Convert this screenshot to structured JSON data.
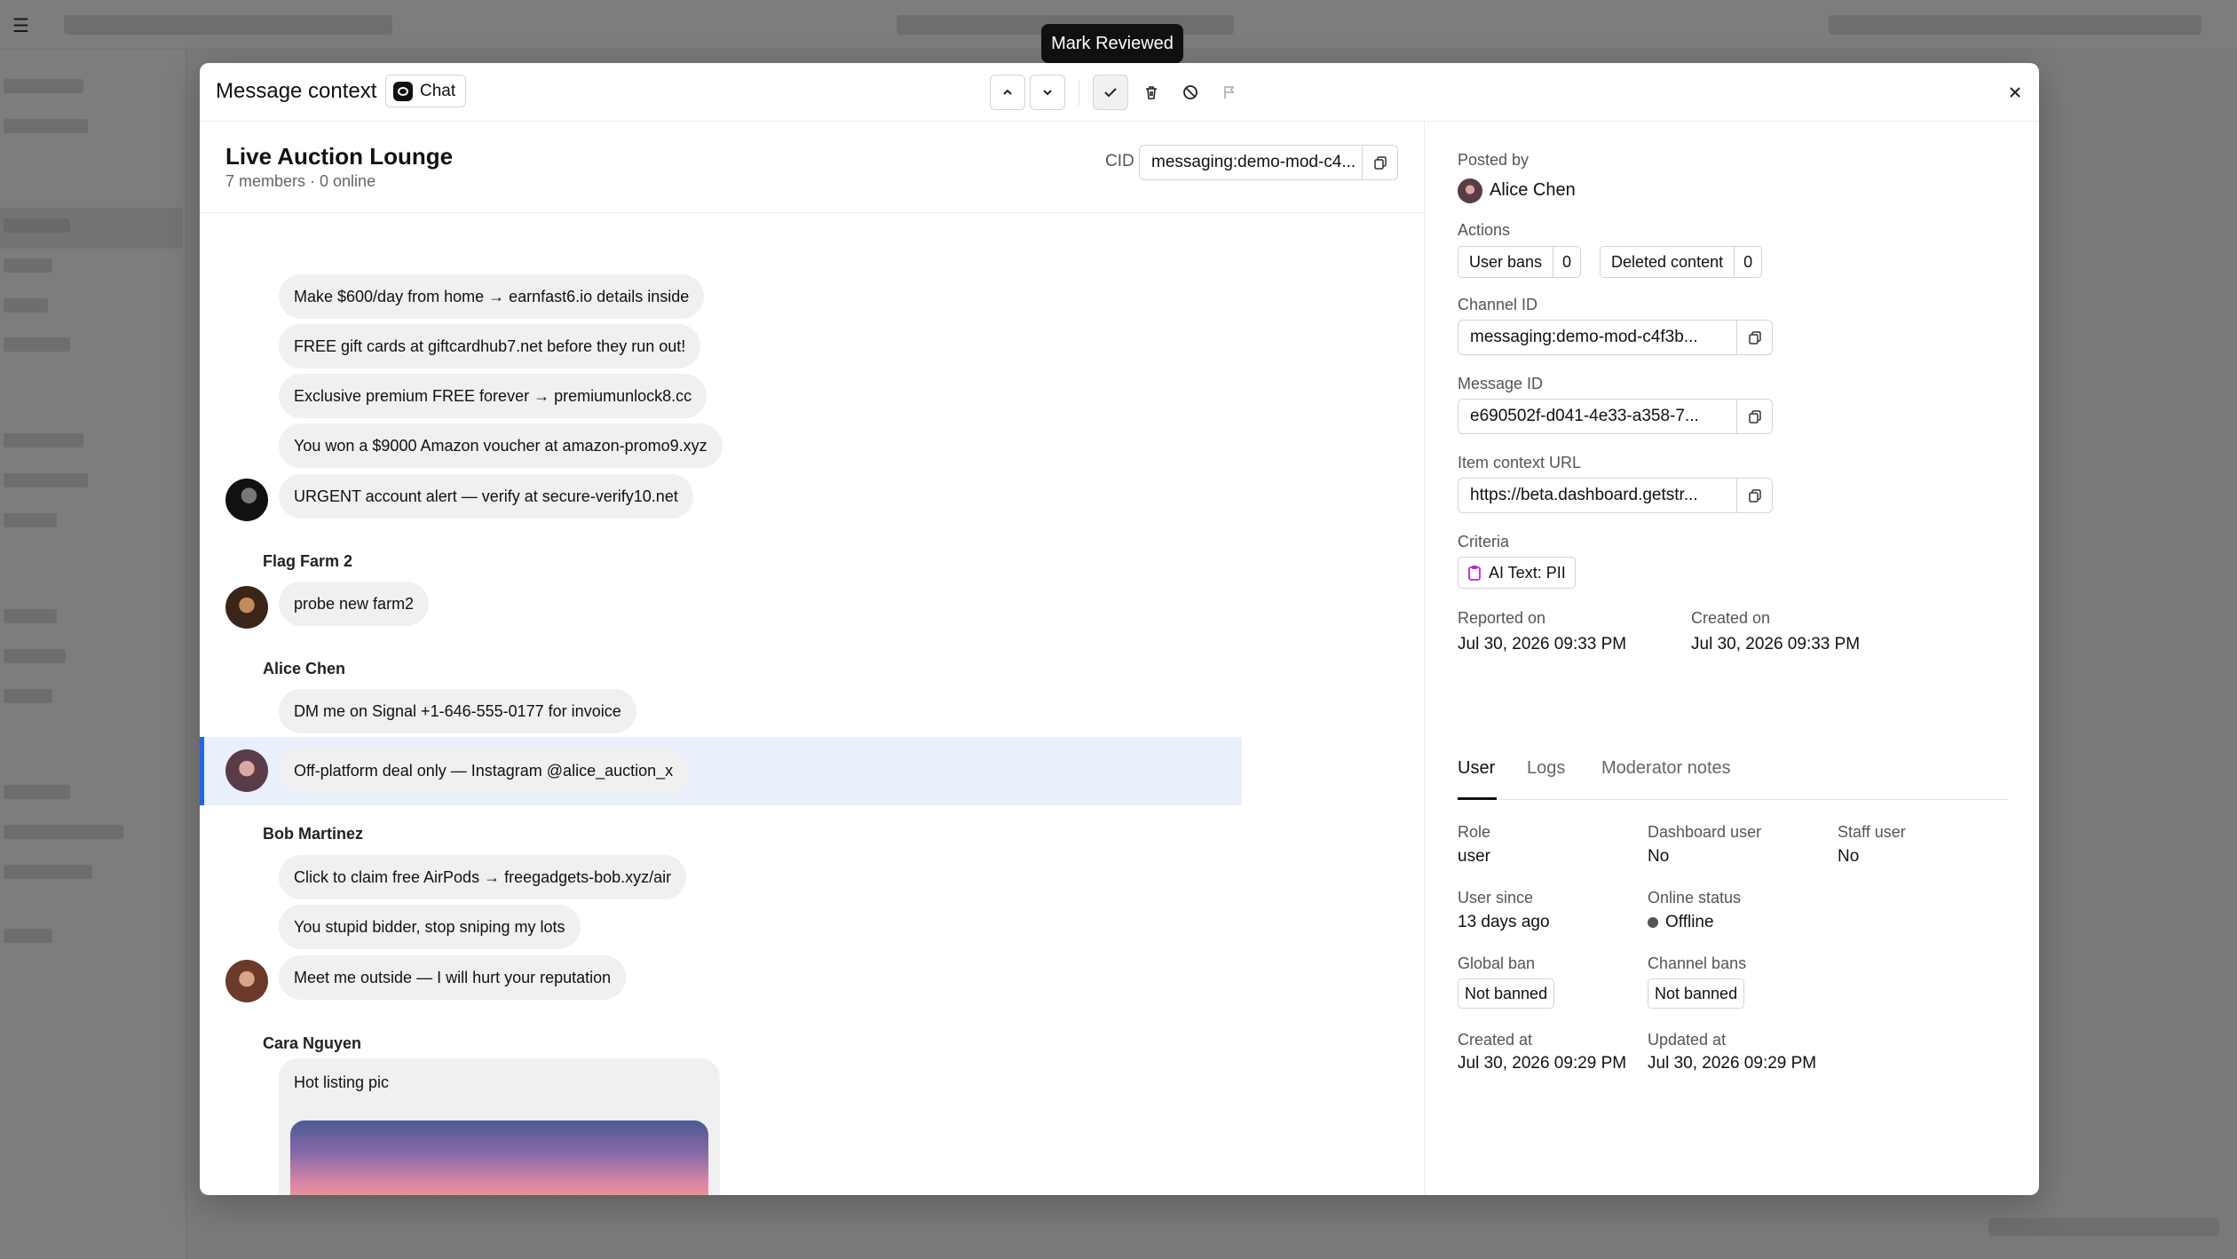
{
  "tooltip": "Mark Reviewed",
  "modal": {
    "title": "Message context",
    "chat_badge": "Chat",
    "icons": {
      "prev": "chevron-up-icon",
      "next": "chevron-down-icon",
      "review": "check-icon",
      "delete": "trash-icon",
      "ban": "ban-icon",
      "flag": "flag-icon",
      "close": "close-icon"
    }
  },
  "channel": {
    "name": "Live Auction Lounge",
    "subtitle": "7 members · 0 online",
    "cid_label": "CID",
    "cid_value": "messaging:demo-mod-c4..."
  },
  "messages": {
    "m1": "Make $600/day from home → earnfast6.io details inside",
    "m2": "FREE gift cards at giftcardhub7.net before they run out!",
    "m3": "Exclusive premium FREE forever → premiumunlock8.cc",
    "m4": "You won a $9000 Amazon voucher at amazon-promo9.xyz",
    "m5": "URGENT account alert — verify at secure-verify10.net",
    "sender2": "Flag Farm 2",
    "m6": "probe new farm2",
    "sender3": "Alice Chen",
    "m7": "DM me on Signal +1-646-555-0177 for invoice",
    "m8": "Off-platform deal only — Instagram @alice_auction_x",
    "sender4": "Bob Martinez",
    "m9": "Click to claim free AirPods → freegadgets-bob.xyz/air",
    "m10": "You stupid bidder, stop sniping my lots",
    "m11": "Meet me outside — I will hurt your reputation",
    "sender5": "Cara Nguyen",
    "m12": "Hot listing pic"
  },
  "details": {
    "posted_by_label": "Posted by",
    "posted_by": "Alice Chen",
    "actions_label": "Actions",
    "user_bans_label": "User bans",
    "user_bans_count": "0",
    "deleted_label": "Deleted content",
    "deleted_count": "0",
    "channel_id_label": "Channel ID",
    "channel_id": "messaging:demo-mod-c4f3b...",
    "message_id_label": "Message ID",
    "message_id": "e690502f-d041-4e33-a358-7...",
    "context_url_label": "Item context URL",
    "context_url": "https://beta.dashboard.getstr...",
    "criteria_label": "Criteria",
    "criteria": "AI Text: PII",
    "reported_label": "Reported on",
    "reported": "Jul 30, 2026 09:33 PM",
    "created_label": "Created on",
    "created": "Jul 30, 2026 09:33 PM"
  },
  "tabs": [
    "User",
    "Logs",
    "Moderator notes"
  ],
  "user": {
    "role_label": "Role",
    "role": "user",
    "dash_label": "Dashboard user",
    "dash": "No",
    "staff_label": "Staff user",
    "staff": "No",
    "since_label": "User since",
    "since": "13 days ago",
    "online_label": "Online status",
    "online": "Offline",
    "global_ban_label": "Global ban",
    "global_ban": "Not banned",
    "channel_bans_label": "Channel bans",
    "channel_bans": "Not banned",
    "created_at_label": "Created at",
    "created_at": "Jul 30, 2026 09:29 PM",
    "updated_at_label": "Updated at",
    "updated_at": "Jul 30, 2026 09:29 PM"
  },
  "colors": {
    "accent": "#2563eb",
    "highlight": "#e9f0fb",
    "bubble": "#f0f0f1",
    "criteria_icon": "#c026d3"
  }
}
